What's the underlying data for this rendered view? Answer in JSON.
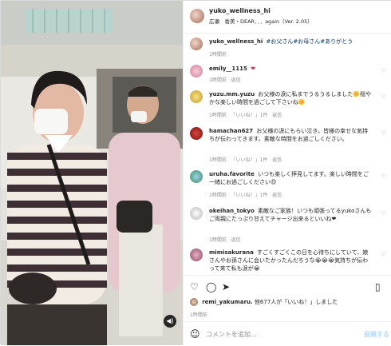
{
  "header": {
    "username": "yuko_wellness_hi",
    "audio": "広瀬　香美・DEAR．．．again（Ver. 2.05）"
  },
  "caption": {
    "username": "yuko_wellness_hi",
    "text": "#お父さん#お母さん#ありがとう",
    "time": "1時間前"
  },
  "comments": [
    {
      "username": "emily__1115",
      "text": "❤",
      "time": "1時間前",
      "likes": "",
      "reply": "返信"
    },
    {
      "username": "yuzu.mm.yuzu",
      "text": "お父様の涙に私までうるうるしました🌼穏やかな楽しい時間を過ごして下さいね🌼",
      "time": "1時間前",
      "likes": "「いいね！」1件",
      "reply": "返信"
    },
    {
      "username": "hamachan627",
      "text": "お父様の涙にもらい泣き。皆様の幸せな気持ちが伝わってきます。素敵な時間をお過ごしください。",
      "time": "1時間前",
      "likes": "「いいね！」1件",
      "reply": "返信"
    },
    {
      "username": "uruha.favorite",
      "text": "いつも楽しく拝見してます。楽しい時間をご一緒にお過ごしください😍",
      "time": "1時間前",
      "likes": "「いいね！」1件",
      "reply": "返信"
    },
    {
      "username": "okeihan_tokyo",
      "text": "素敵なご家族！いつも頑張ってるyukoさんもご両親にたっぷり甘えてチャージ出来るといいね❤",
      "time": "1時間前",
      "likes": "",
      "reply": "返信"
    },
    {
      "username": "mimisakurana",
      "text": "すごくすごくこの日を心待ちにしていて、娘さんやお孫さんに会いたかったんだろうな😭😭😭気持ちが伝わって来て私も涙が😭",
      "time": "",
      "likes": "",
      "reply": ""
    }
  ],
  "actions": {
    "like_icon": "heart-icon",
    "comment_icon": "comment-icon",
    "share_icon": "share-icon",
    "save_icon": "bookmark-icon"
  },
  "likes_line": {
    "user": "remi_yakumaru.",
    "text": "他677人が「いいね！」しました"
  },
  "post_time": "1時間前",
  "add_comment": {
    "placeholder": "コメントを追加...",
    "post_label": "投稿する"
  }
}
